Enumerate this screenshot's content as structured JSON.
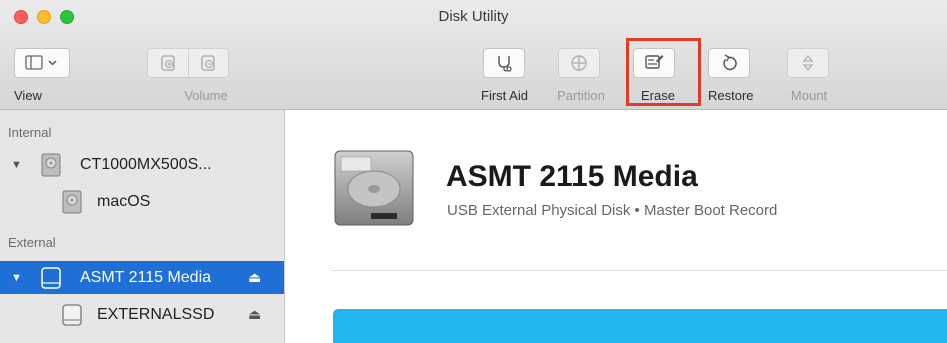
{
  "window": {
    "title": "Disk Utility"
  },
  "toolbar": {
    "view_label": "View",
    "volume_label": "Volume",
    "first_aid_label": "First Aid",
    "partition_label": "Partition",
    "erase_label": "Erase",
    "restore_label": "Restore",
    "mount_label": "Mount",
    "view_icon": "sidebar-icon",
    "first_aid_icon": "stethoscope-icon",
    "partition_icon": "pie-icon",
    "erase_icon": "erase-icon",
    "restore_icon": "restore-icon",
    "mount_icon": "mount-icon"
  },
  "sidebar": {
    "internal_header": "Internal",
    "external_header": "External",
    "items": [
      {
        "label": "CT1000MX500S...",
        "kind": "internal-disk",
        "selected": false
      },
      {
        "label": "macOS",
        "kind": "volume",
        "selected": false
      },
      {
        "label": "ASMT 2115 Media",
        "kind": "external-disk",
        "selected": true
      },
      {
        "label": "EXTERNALSSD",
        "kind": "external-volume",
        "selected": false
      }
    ],
    "eject_glyph": "⏏"
  },
  "detail": {
    "title": "ASMT 2115 Media",
    "subtitle": "USB External Physical Disk • Master Boot Record"
  },
  "colors": {
    "selection": "#1e6fd6",
    "highlight_box": "#e03b24",
    "usage_bar": "#21b5ef"
  }
}
